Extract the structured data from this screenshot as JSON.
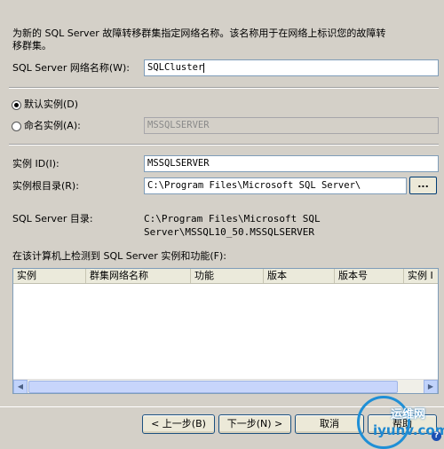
{
  "description_line1": "为新的 SQL Server 故障转移群集指定网络名称。该名称用于在网络上标识您的故障转",
  "description_line2": "移群集。",
  "network_name": {
    "label": "SQL Server 网络名称(W):",
    "value": "SQLCluster"
  },
  "default_instance": {
    "label": "默认实例(D)",
    "selected": true
  },
  "named_instance": {
    "label": "命名实例(A):",
    "value": "MSSQLSERVER",
    "selected": false
  },
  "instance_id": {
    "label": "实例 ID(I):",
    "value": "MSSQLSERVER"
  },
  "instance_root": {
    "label": "实例根目录(R):",
    "value": "C:\\Program Files\\Microsoft SQL Server\\",
    "browse_label": "..."
  },
  "sql_dir": {
    "label": "SQL Server 目录:",
    "line1": "C:\\Program Files\\Microsoft SQL",
    "line2": "Server\\MSSQL10_50.MSSQLSERVER"
  },
  "detected": {
    "label": "在该计算机上检测到 SQL Server 实例和功能(F):",
    "columns": [
      "实例",
      "群集网络名称",
      "功能",
      "版本",
      "版本号",
      "实例 I"
    ]
  },
  "buttons": {
    "back": "< 上一步(B)",
    "next": "下一步(N) >",
    "cancel": "取消",
    "help": "帮助"
  },
  "watermark": {
    "cn": "运维网",
    "en": "iyunv.com"
  }
}
